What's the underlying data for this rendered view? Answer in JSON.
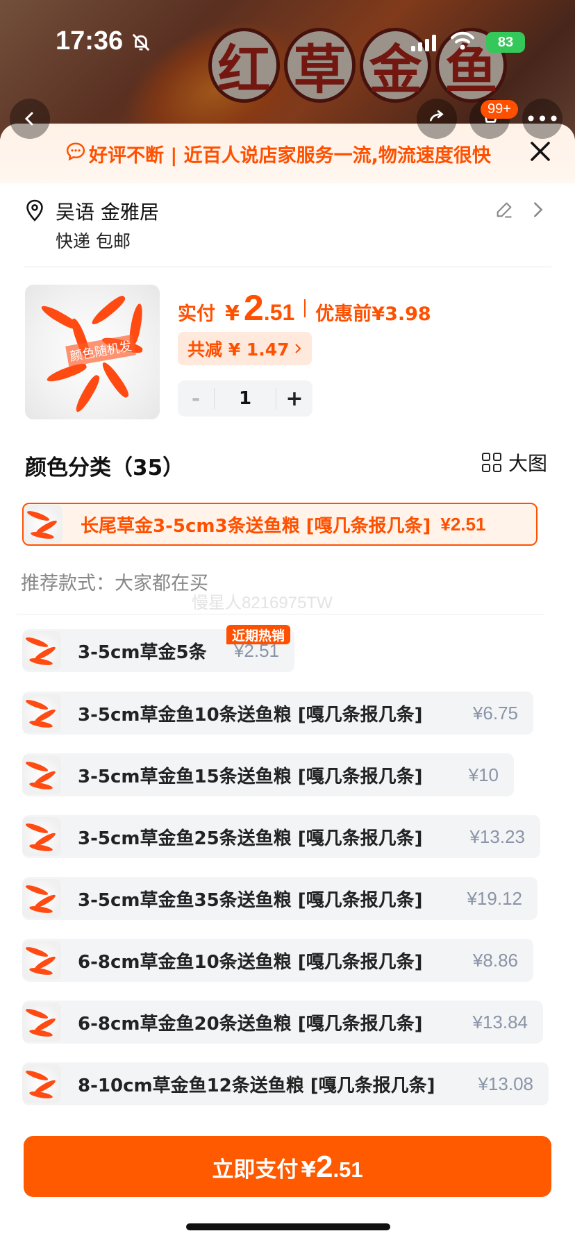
{
  "status": {
    "time": "17:36",
    "battery": "83"
  },
  "backdrop": {
    "title_chars": [
      "红",
      "草",
      "金",
      "鱼"
    ],
    "cart_badge": "99+"
  },
  "banner": {
    "text": "好评不断 | 近百人说店家服务一流,物流速度很快"
  },
  "address": {
    "name": "吴语 金雅居",
    "shipping": "快递 包邮"
  },
  "product": {
    "image_tag": "颜色随机发",
    "price_label": "实付",
    "yen": "¥",
    "price_int": "2",
    "price_dec": ".51",
    "orig_label": "优惠前",
    "orig_price": "¥3.98",
    "discount_text": "共减 ¥ 1.47",
    "qty": "1",
    "minus": "-",
    "plus": "+"
  },
  "colors": {
    "heading": "颜色分类（35）",
    "big_view": "大图",
    "selected": {
      "label": "长尾草金3-5cm3条送鱼粮 [嘎几条报几条]",
      "price": "¥2.51"
    }
  },
  "recommend": {
    "heading": "推荐款式：大家都在买",
    "watermark": "慢星人8216975TW",
    "hot_badge": "近期热销"
  },
  "options": [
    {
      "label": "3-5cm草金5条",
      "price": "¥2.51"
    },
    {
      "label": "3-5cm草金鱼10条送鱼粮 [嘎几条报几条]",
      "price": "¥6.75"
    },
    {
      "label": "3-5cm草金鱼15条送鱼粮 [嘎几条报几条]",
      "price": "¥10"
    },
    {
      "label": "3-5cm草金鱼25条送鱼粮 [嘎几条报几条]",
      "price": "¥13.23"
    },
    {
      "label": "3-5cm草金鱼35条送鱼粮 [嘎几条报几条]",
      "price": "¥19.12"
    },
    {
      "label": "6-8cm草金鱼10条送鱼粮 [嘎几条报几条]",
      "price": "¥8.86"
    },
    {
      "label": "6-8cm草金鱼20条送鱼粮 [嘎几条报几条]",
      "price": "¥13.84"
    },
    {
      "label": "8-10cm草金鱼12条送鱼粮 [嘎几条报几条]",
      "price": "¥13.08"
    }
  ],
  "pay": {
    "label": "立即支付",
    "yen": "¥",
    "int": "2",
    "dec": ".51"
  },
  "theme": {
    "accent": "#ff5000",
    "chip_bg": "#ffe9dc",
    "option_bg": "#f3f4f6",
    "price_gray": "#8a94a6"
  }
}
